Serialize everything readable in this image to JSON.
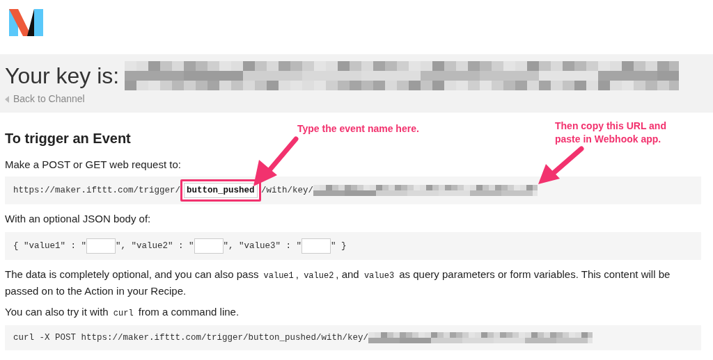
{
  "header": {
    "key_heading": "Your key is:",
    "back_link": "Back to Channel"
  },
  "section": {
    "title": "To trigger an Event",
    "intro": "Make a POST or GET web request to:",
    "url": {
      "prefix": "https://maker.ifttt.com/trigger/",
      "event_name": "button_pushed",
      "suffix": "/with/key/"
    },
    "body_intro": "With an optional JSON body of:",
    "json_body": [
      {
        "kind": "text",
        "text": "{ \"value1\" : \""
      },
      {
        "kind": "field"
      },
      {
        "kind": "text",
        "text": "\", \"value2\" : \""
      },
      {
        "kind": "field"
      },
      {
        "kind": "text",
        "text": "\", \"value3\" : \""
      },
      {
        "kind": "field"
      },
      {
        "kind": "text",
        "text": "\" }"
      }
    ],
    "note": [
      {
        "kind": "text",
        "text": "The data is completely optional, and you can also pass "
      },
      {
        "kind": "code",
        "text": "value1"
      },
      {
        "kind": "text",
        "text": ", "
      },
      {
        "kind": "code",
        "text": "value2"
      },
      {
        "kind": "text",
        "text": ", and "
      },
      {
        "kind": "code",
        "text": "value3"
      },
      {
        "kind": "text",
        "text": " as query parameters or form variables. This content will be passed on to the Action in your Recipe."
      }
    ],
    "curl_intro": [
      {
        "kind": "text",
        "text": "You can also try it with "
      },
      {
        "kind": "code",
        "text": "curl"
      },
      {
        "kind": "text",
        "text": " from a command line."
      }
    ],
    "curl_command": "curl -X POST https://maker.ifttt.com/trigger/button_pushed/with/key/"
  },
  "annotations": [
    {
      "text": "Type the event name here."
    },
    {
      "text": "Then copy this URL and paste in Webhook app."
    }
  ]
}
